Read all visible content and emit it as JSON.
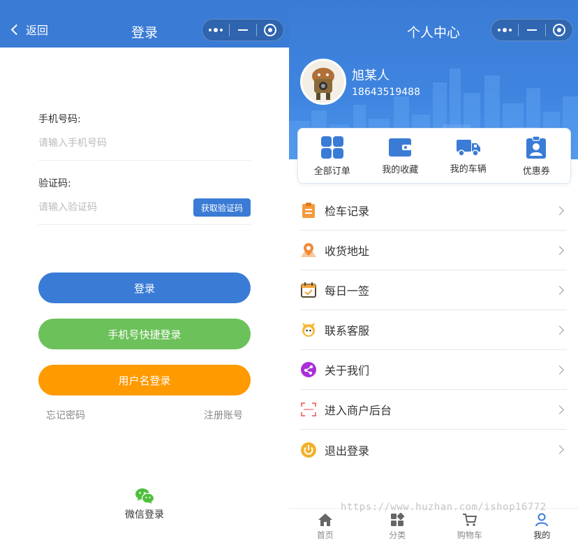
{
  "login": {
    "nav": {
      "back_label": "返回",
      "title": "登录"
    },
    "phone": {
      "label": "手机号码:",
      "placeholder": "请输入手机号码"
    },
    "code": {
      "label": "验证码:",
      "placeholder": "请输入验证码",
      "button": "获取验证码"
    },
    "buttons": {
      "login": "登录",
      "phone_quick": "手机号快捷登录",
      "username": "用户名登录"
    },
    "links": {
      "forgot": "忘记密码",
      "register": "注册账号"
    },
    "wechat": {
      "label": "微信登录"
    }
  },
  "profile": {
    "nav": {
      "title": "个人中心"
    },
    "user": {
      "name": "旭某人",
      "phone": "18643519488"
    },
    "quick": [
      {
        "label": "全部订单",
        "icon": "grid-icon"
      },
      {
        "label": "我的收藏",
        "icon": "wallet-icon"
      },
      {
        "label": "我的车辆",
        "icon": "truck-icon"
      },
      {
        "label": "优惠券",
        "icon": "badge-icon"
      }
    ],
    "menu": [
      {
        "label": "检车记录",
        "icon": "clipboard-icon"
      },
      {
        "label": "收货地址",
        "icon": "map-pin-icon"
      },
      {
        "label": "每日一签",
        "icon": "calendar-check-icon"
      },
      {
        "label": "联系客服",
        "icon": "customer-service-icon"
      },
      {
        "label": "关于我们",
        "icon": "share-icon"
      },
      {
        "label": "进入商户后台",
        "icon": "scan-icon"
      },
      {
        "label": "退出登录",
        "icon": "power-icon"
      }
    ],
    "tabs": [
      {
        "label": "首页",
        "icon": "home-icon"
      },
      {
        "label": "分类",
        "icon": "category-icon"
      },
      {
        "label": "购物车",
        "icon": "cart-icon"
      },
      {
        "label": "我的",
        "icon": "user-icon"
      }
    ]
  },
  "watermark": "https://www.huzhan.com/ishop16772",
  "colors": {
    "primary": "#3a7bd5",
    "green": "#6cc15a",
    "orange": "#ff9a00"
  }
}
